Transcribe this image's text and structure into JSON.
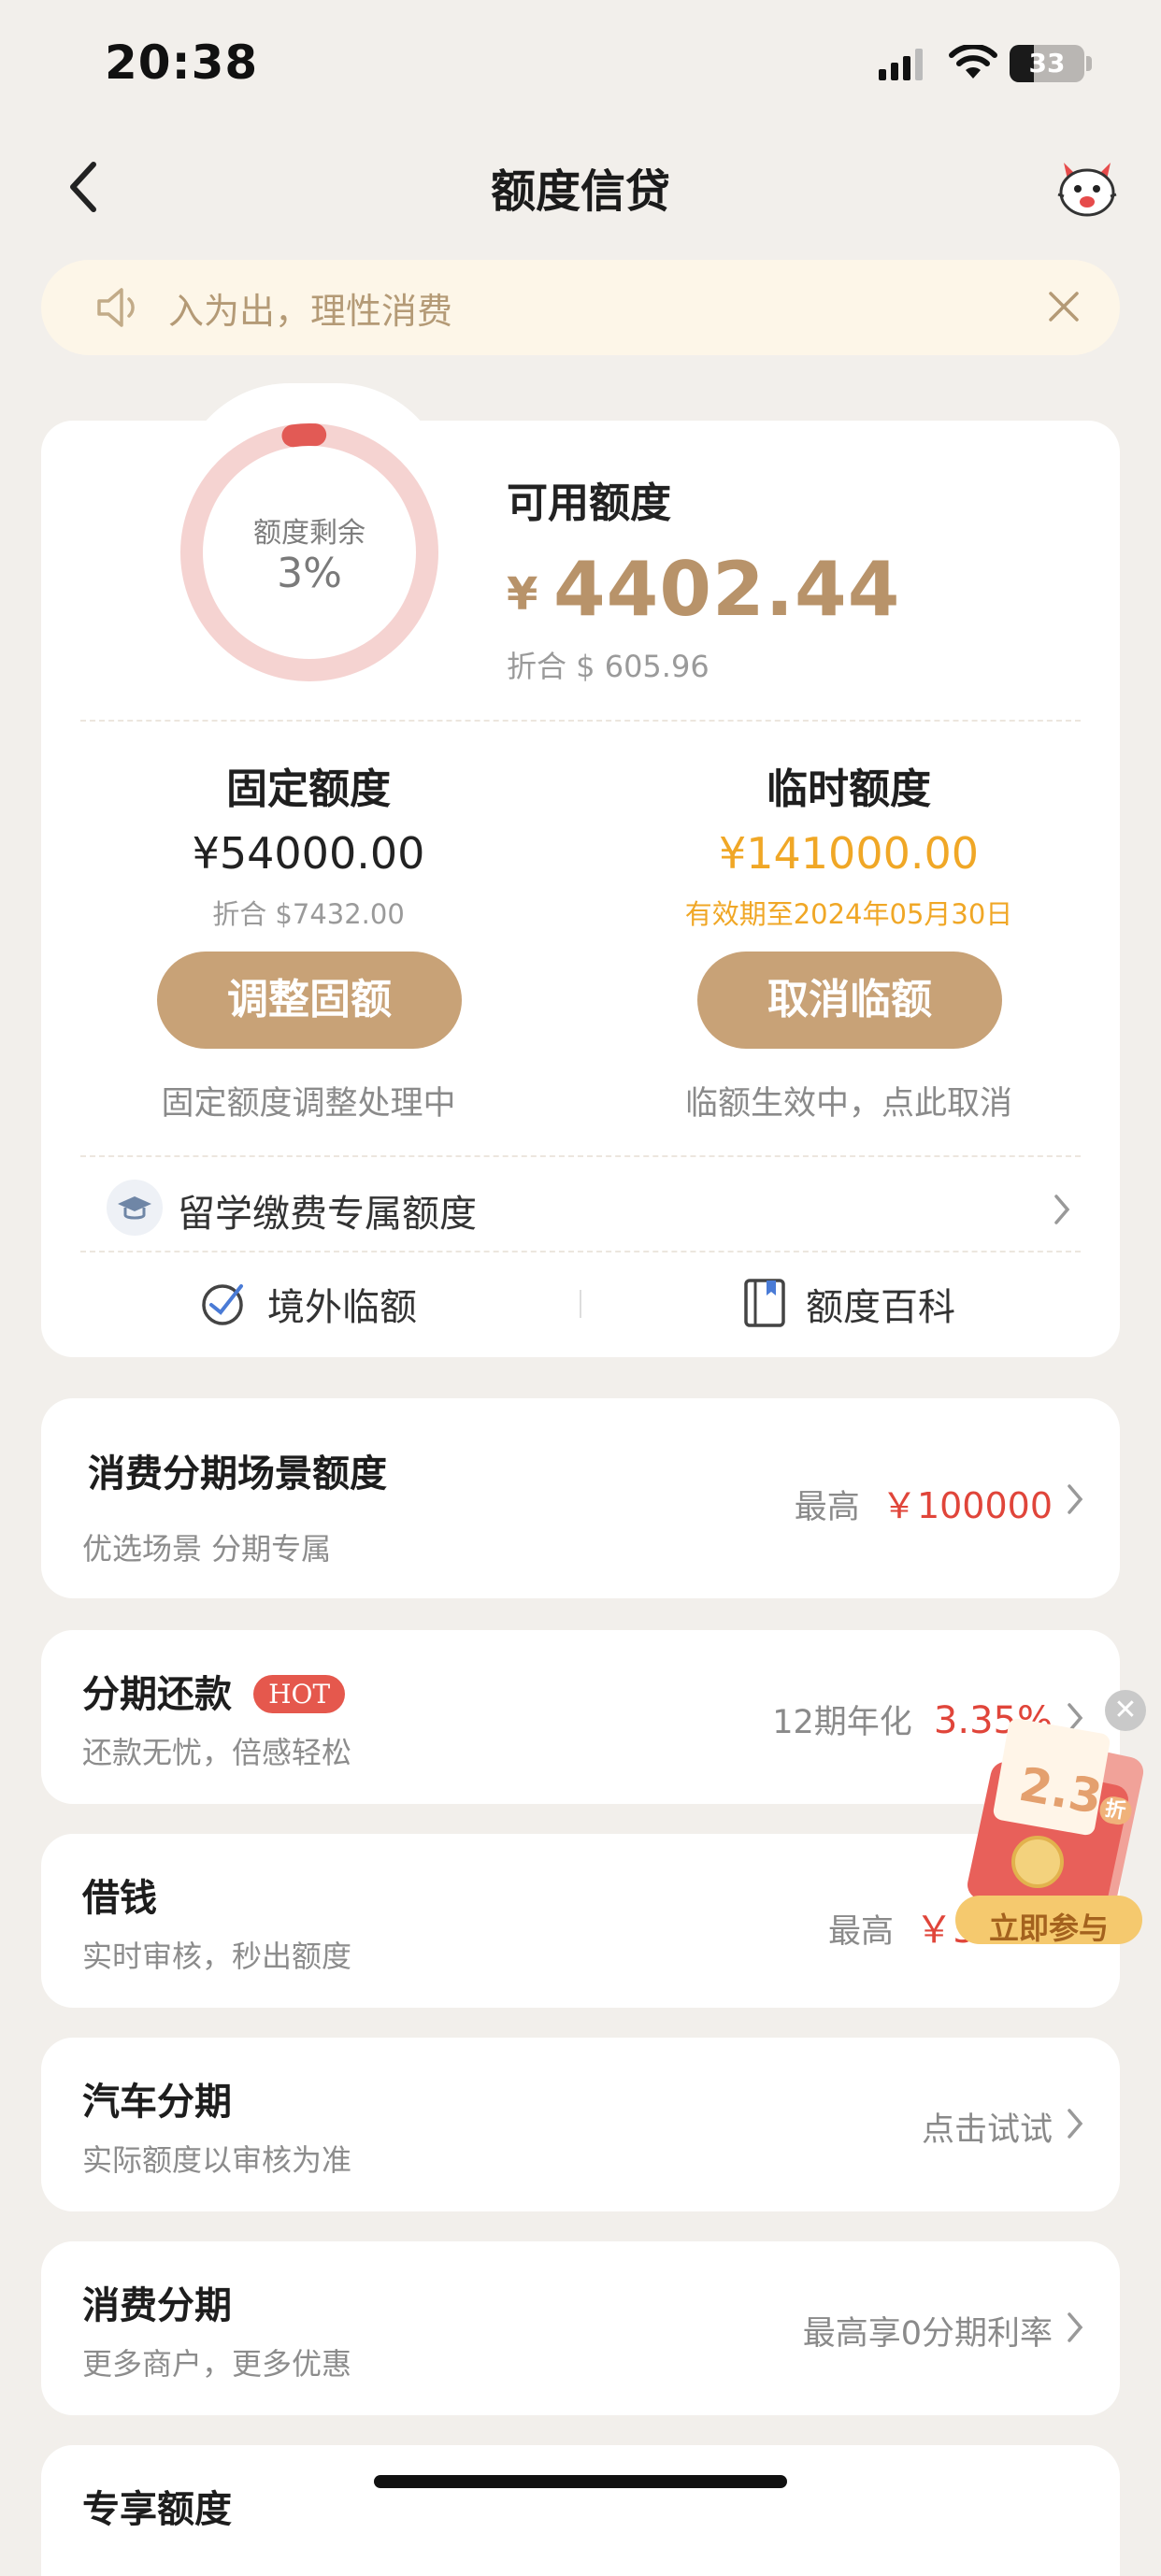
{
  "status_bar": {
    "time": "20:38",
    "battery": "33"
  },
  "nav": {
    "title": "额度信贷"
  },
  "notice": {
    "text": "入为出，理性消费"
  },
  "ring": {
    "label": "额度剩余",
    "percent": "3%",
    "fraction": 0.03
  },
  "available": {
    "label": "可用额度",
    "currency": "¥",
    "amount": "4402.44",
    "converted": "折合 $ 605.96"
  },
  "fixed": {
    "title": "固定额度",
    "amount": "¥54000.00",
    "converted": "折合 $7432.00",
    "button": "调整固额",
    "note": "固定额度调整处理中"
  },
  "temp": {
    "title": "临时额度",
    "amount": "¥141000.00",
    "validity": "有效期至2024年05月30日",
    "button": "取消临额",
    "note": "临额生效中，点此取消"
  },
  "study_abroad": {
    "label": "留学缴费专属额度"
  },
  "links": {
    "overseas": "境外临额",
    "wiki": "额度百科"
  },
  "items": [
    {
      "title": "消费分期场景额度",
      "sub": "优选场景 分期专属",
      "right_prefix": "最高",
      "right_value": "￥100000"
    },
    {
      "title": "分期还款",
      "badge": "HOT",
      "sub": "还款无忧，倍感轻松",
      "right_prefix": "12期年化",
      "right_value": "3.35%"
    },
    {
      "title": "借钱",
      "sub": "实时审核，秒出额度",
      "right_prefix": "最高",
      "right_value": "￥5"
    },
    {
      "title": "汽车分期",
      "sub": "实际额度以审核为准",
      "right_text": "点击试试"
    },
    {
      "title": "消费分期",
      "sub": "更多商户，更多优惠",
      "right_text": "最高享0分期利率"
    },
    {
      "title": "专享额度"
    }
  ],
  "promo": {
    "discount": "2.3",
    "discount_unit": "折",
    "button": "立即参与"
  },
  "colors": {
    "accent": "#c8a277",
    "gold_text": "#b8936a",
    "temp_amount": "#f0a726",
    "red": "#e0453a",
    "ring_track": "#f5d3d1",
    "ring_fill": "#e25a55"
  }
}
